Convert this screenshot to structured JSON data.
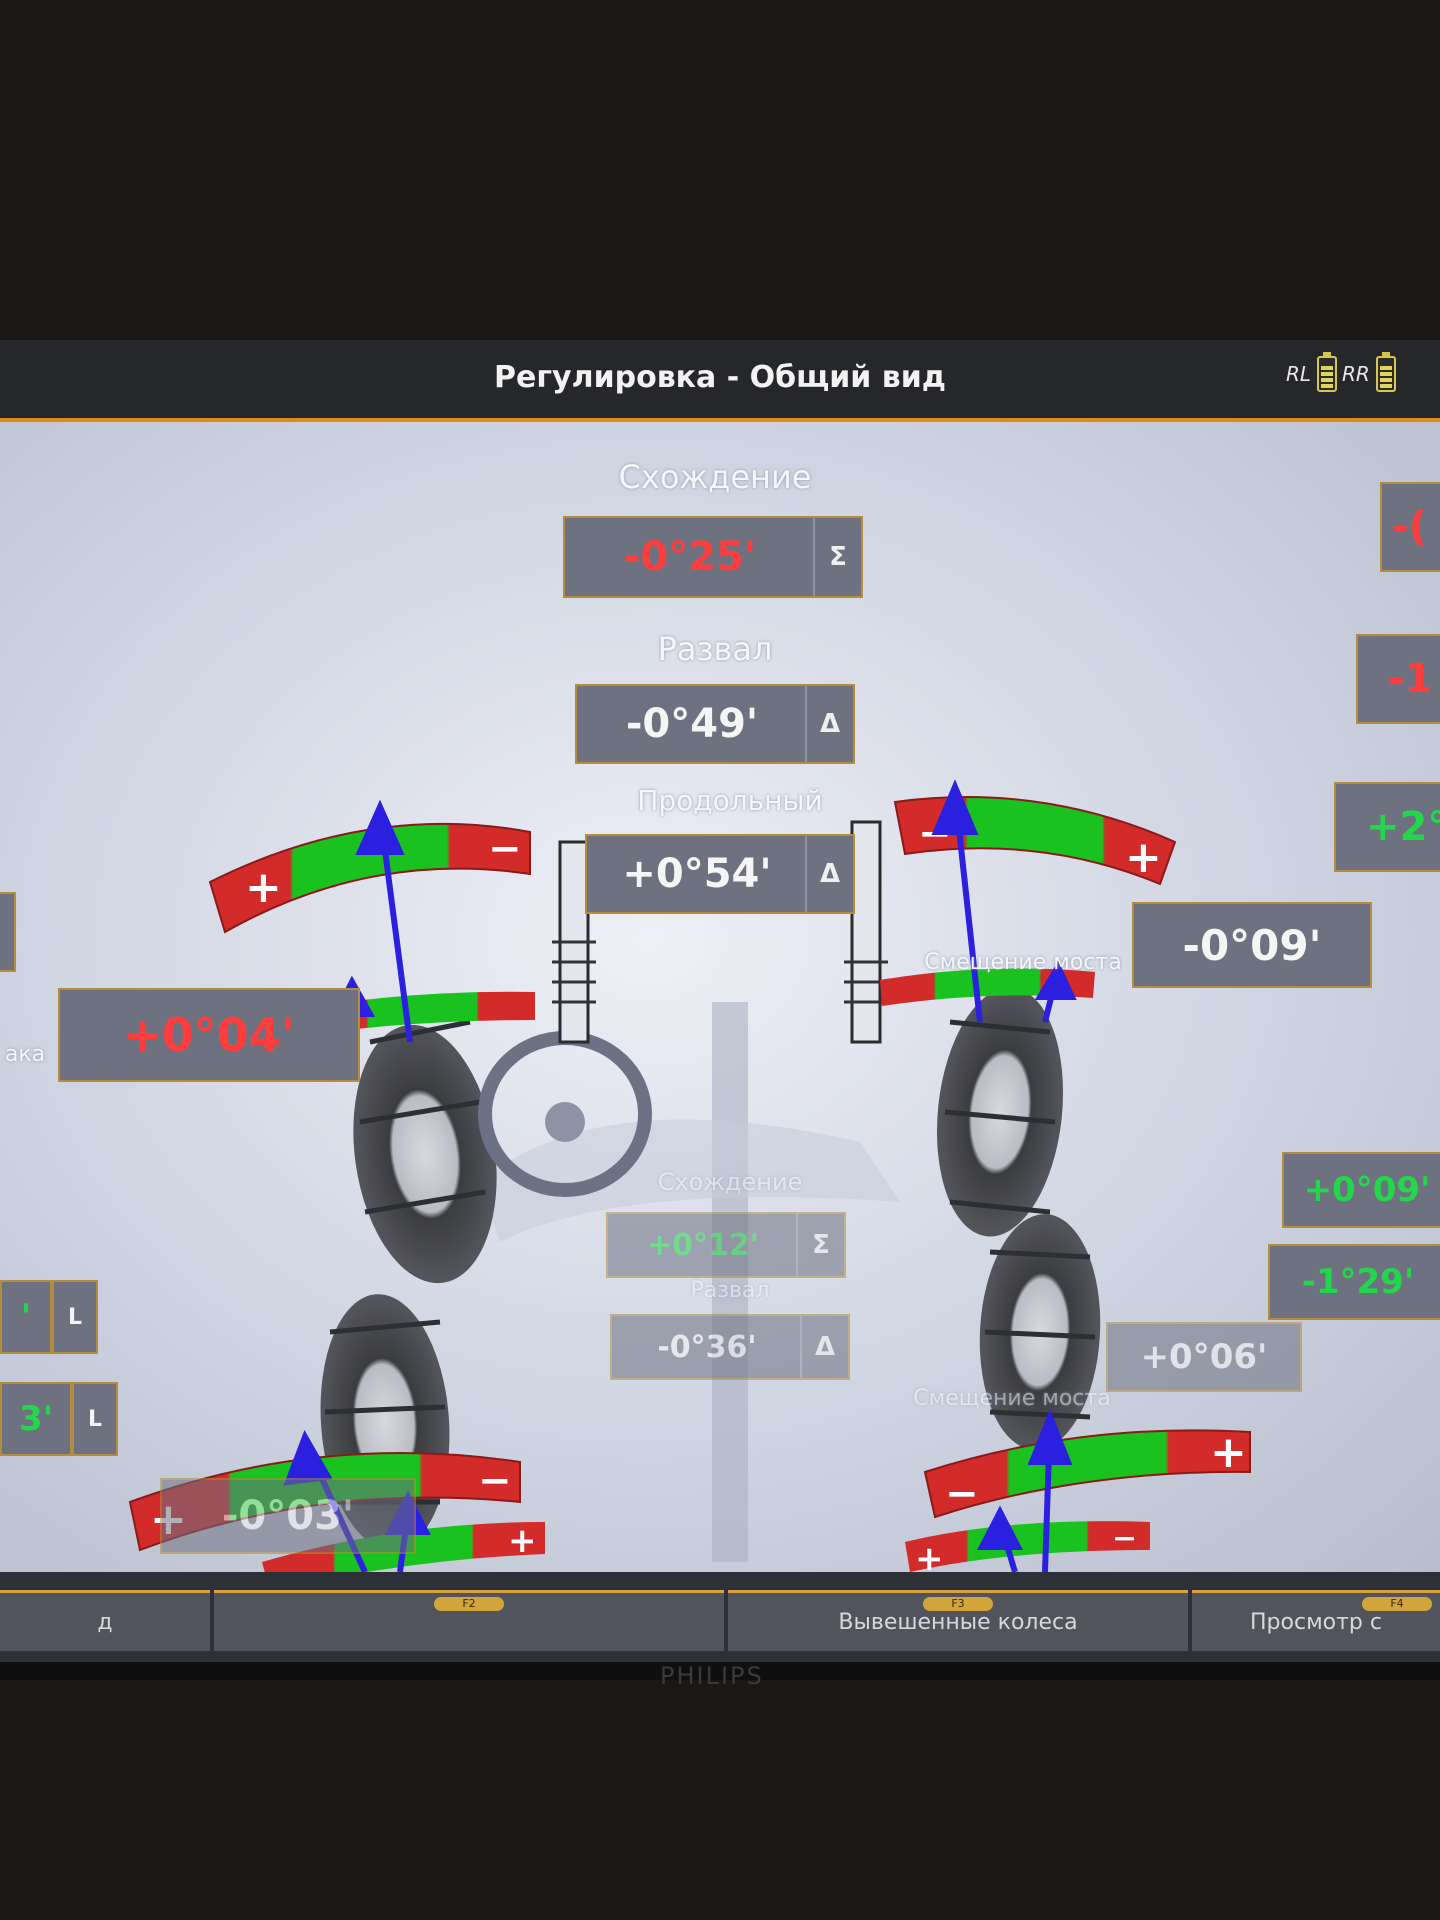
{
  "header": {
    "title": "Регулировка - Общий вид",
    "battery_left_label": "RL",
    "battery_right_label": "RR"
  },
  "front": {
    "toe_label": "Схождение",
    "toe_value": "-0°25'",
    "toe_symbol": "Σ",
    "camber_label": "Развал",
    "camber_value": "-0°49'",
    "camber_symbol": "Δ",
    "caster_label": "Продольный",
    "caster_value": "+0°54'",
    "caster_symbol": "Δ",
    "setback_label": "Смещение моста",
    "setback_value": "-0°09'",
    "left_partial_label": "ака",
    "left_partial_value": "+0°04'",
    "right_toe_partial": "-(",
    "right_camber_partial": "-1",
    "right_caster_partial": "+2°"
  },
  "rear": {
    "toe_label": "Схождение",
    "toe_value": "+0°12'",
    "toe_symbol": "Σ",
    "camber_label": "Развал",
    "camber_value": "-0°36'",
    "camber_symbol": "Δ",
    "setback_label": "Смещение моста",
    "setback_value": "+0°06'",
    "right_toe_value": "+0°09'",
    "right_camber_value": "-1°29'",
    "left_thrust_value": "-0°03'",
    "left_row1_marker": "L",
    "left_row2_marker": "L",
    "left_row2_partial": "3'",
    "left_row1_partial": "'"
  },
  "tabs": [
    {
      "label": "д",
      "key": ""
    },
    {
      "label": "",
      "key": "F2"
    },
    {
      "label": "Вывешенные колеса",
      "key": "F3"
    },
    {
      "label": "Просмотр с",
      "key": "F4"
    }
  ],
  "bezel": {
    "brand": "PHILIPS"
  },
  "colors": {
    "accent": "#e08a1e",
    "good": "#22d84a",
    "bad": "#ff3d3d",
    "pointer": "#2b1fe0"
  }
}
